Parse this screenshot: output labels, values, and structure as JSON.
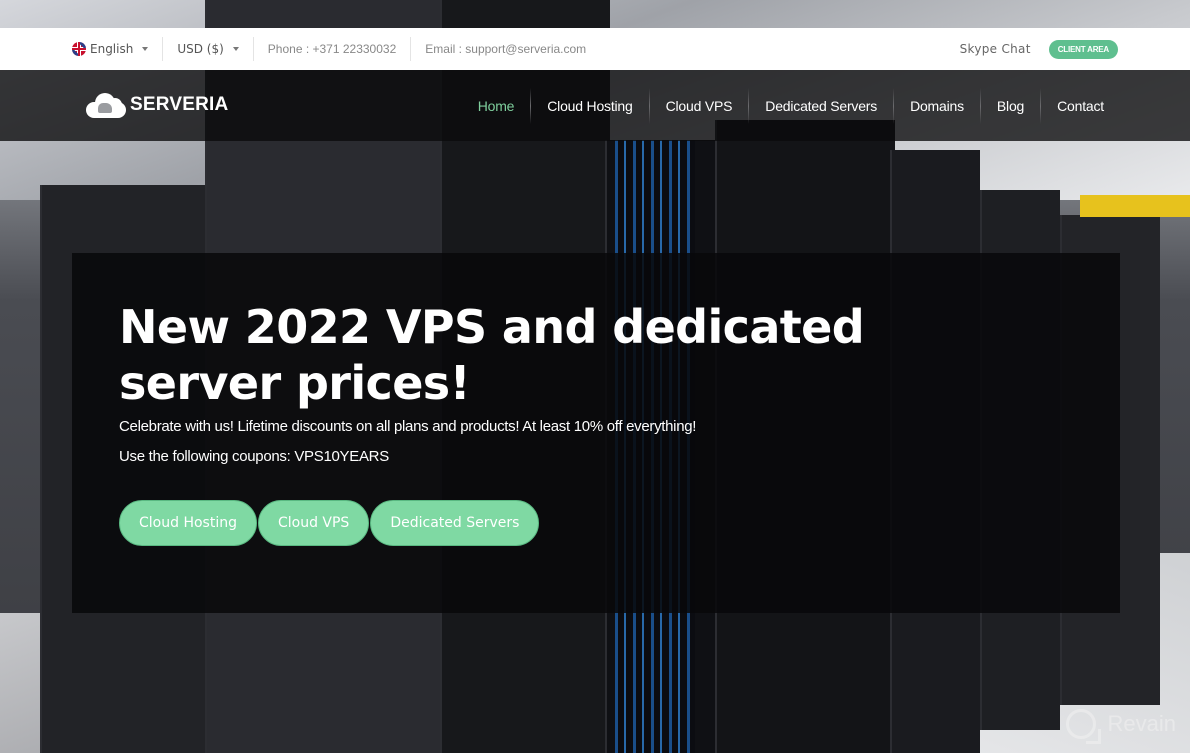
{
  "topbar": {
    "language": "English",
    "currency": "USD ($)",
    "phone": "Phone : +371 22330032",
    "email": "Email : support@serveria.com",
    "skype": "Skype Chat",
    "client_area": "CLIENT AREA"
  },
  "brand": {
    "name": "SERVERIA",
    "logo_icon": "cloud-elephant-icon",
    "accent_color": "#5fbf8f"
  },
  "nav": {
    "items": [
      {
        "label": "Home",
        "active": true
      },
      {
        "label": "Cloud Hosting",
        "active": false
      },
      {
        "label": "Cloud VPS",
        "active": false
      },
      {
        "label": "Dedicated Servers",
        "active": false
      },
      {
        "label": "Domains",
        "active": false
      },
      {
        "label": "Blog",
        "active": false
      },
      {
        "label": "Contact",
        "active": false
      }
    ]
  },
  "hero": {
    "title": "New 2022 VPS and dedicated server prices!",
    "subtitle": "Celebrate with us! Lifetime discounts on all plans and products! At least 10% off everything!",
    "coupon_line": "Use the following coupons: VPS10YEARS",
    "buttons": [
      {
        "label": "Cloud Hosting"
      },
      {
        "label": "Cloud VPS"
      },
      {
        "label": "Dedicated Servers"
      }
    ],
    "button_color": "#7fd9a3"
  },
  "watermark": {
    "text": "Revain"
  }
}
